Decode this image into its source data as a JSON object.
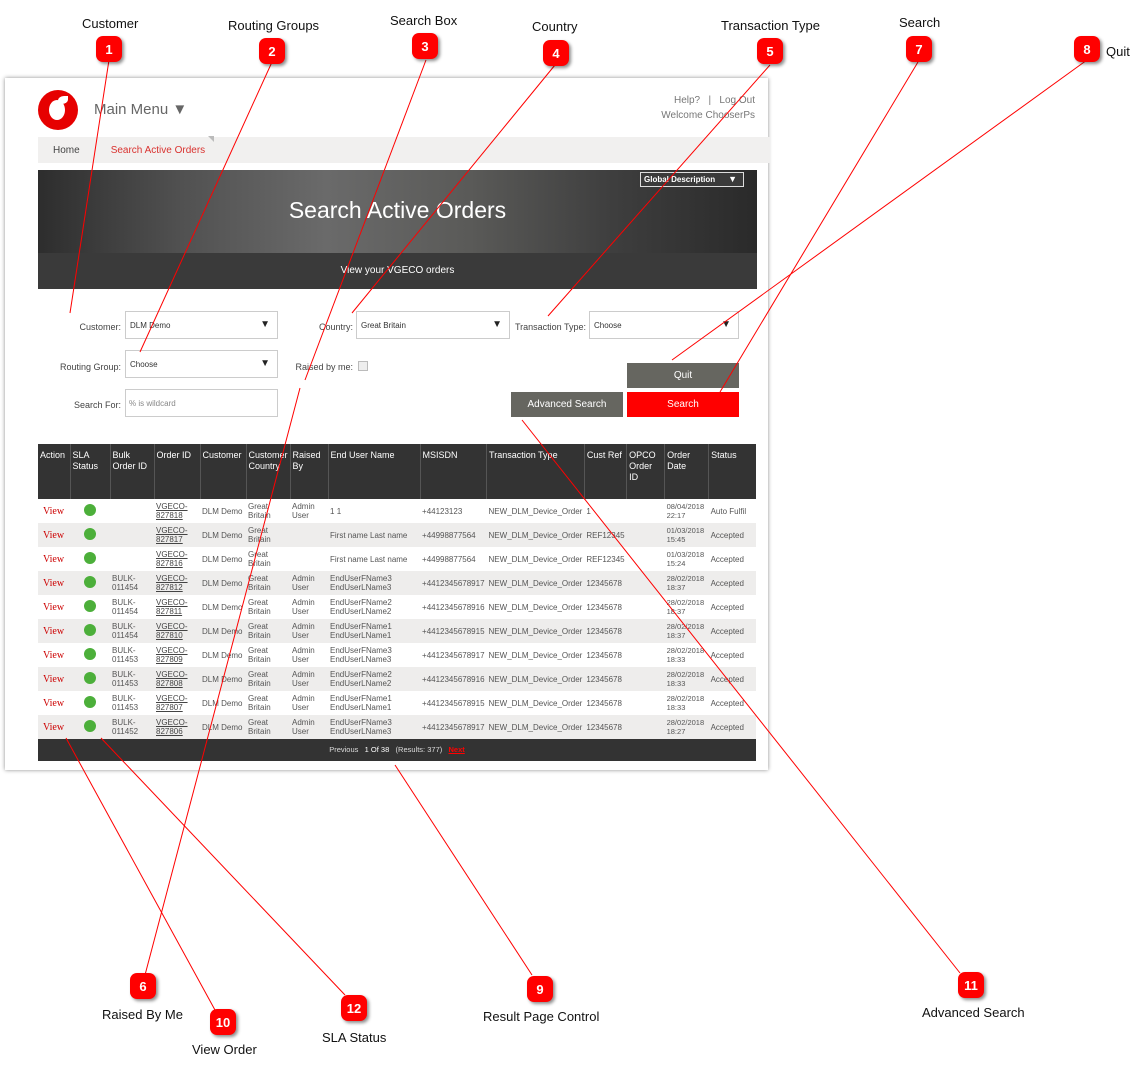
{
  "annotations": [
    {
      "num": "1",
      "label": "Customer"
    },
    {
      "num": "2",
      "label": "Routing Groups"
    },
    {
      "num": "3",
      "label": "Search Box"
    },
    {
      "num": "4",
      "label": "Country"
    },
    {
      "num": "5",
      "label": "Transaction Type"
    },
    {
      "num": "6",
      "label": "Raised By Me"
    },
    {
      "num": "7",
      "label": "Search"
    },
    {
      "num": "8",
      "label": "Quit"
    },
    {
      "num": "9",
      "label": "Result Page Control"
    },
    {
      "num": "10",
      "label": "View Order"
    },
    {
      "num": "11",
      "label": "Advanced Search"
    },
    {
      "num": "12",
      "label": "SLA Status"
    }
  ],
  "header": {
    "main_menu": "Main Menu ▼",
    "help": "Help?",
    "separator": "|",
    "logout": "Log Out",
    "welcome": "Welcome ChooserPs"
  },
  "breadcrumb": {
    "home": "Home",
    "current": "Search Active Orders"
  },
  "hero": {
    "title": "Search Active Orders",
    "subtitle": "View your VGECO orders",
    "global_description": "Global Description",
    "dropdown_arrow": "▼"
  },
  "form": {
    "customer_label": "Customer:",
    "customer_value": "DLM Demo",
    "country_label": "Country:",
    "country_value": "Great Britain",
    "transaction_type_label": "Transaction Type:",
    "transaction_type_value": "Choose",
    "routing_group_label": "Routing Group:",
    "routing_group_value": "Choose",
    "raised_by_me_label": "Raised by me:",
    "search_for_label": "Search For:",
    "search_for_placeholder": "% is wildcard",
    "arrow": "▼",
    "quit": "Quit",
    "advanced_search": "Advanced Search",
    "search": "Search"
  },
  "table": {
    "headers": [
      "Action",
      "SLA Status",
      "Bulk Order ID",
      "Order ID",
      "Customer",
      "Customer Country",
      "Raised By",
      "End User Name",
      "MSISDN",
      "Transaction Type",
      "Cust Ref",
      "OPCO Order ID",
      "Order Date",
      "Status"
    ],
    "rows": [
      {
        "action": "View",
        "sla": "green",
        "bulk": "",
        "order": "VGECO-827818",
        "customer": "DLM Demo",
        "country": "Great Britain",
        "raised_by": "Admin User",
        "end_user": "1 1",
        "msisdn": "+44123123",
        "type": "NEW_DLM_Device_Order",
        "cust_ref": "1",
        "opco": "",
        "date": "08/04/2018 22:17",
        "status": "Auto Fulfil"
      },
      {
        "action": "View",
        "sla": "green",
        "bulk": "",
        "order": "VGECO-827817",
        "customer": "DLM Demo",
        "country": "Great Britain",
        "raised_by": "",
        "end_user": "First name Last name",
        "msisdn": "+44998877564",
        "type": "NEW_DLM_Device_Order",
        "cust_ref": "REF12345",
        "opco": "",
        "date": "01/03/2018 15:45",
        "status": "Accepted"
      },
      {
        "action": "View",
        "sla": "green",
        "bulk": "",
        "order": "VGECO-827816",
        "customer": "DLM Demo",
        "country": "Great Britain",
        "raised_by": "",
        "end_user": "First name Last name",
        "msisdn": "+44998877564",
        "type": "NEW_DLM_Device_Order",
        "cust_ref": "REF12345",
        "opco": "",
        "date": "01/03/2018 15:24",
        "status": "Accepted"
      },
      {
        "action": "View",
        "sla": "green",
        "bulk": "BULK-011454",
        "order": "VGECO-827812",
        "customer": "DLM Demo",
        "country": "Great Britain",
        "raised_by": "Admin User",
        "end_user": "EndUserFName3 EndUserLName3",
        "msisdn": "+4412345678917",
        "type": "NEW_DLM_Device_Order",
        "cust_ref": "12345678",
        "opco": "",
        "date": "28/02/2018 18:37",
        "status": "Accepted"
      },
      {
        "action": "View",
        "sla": "green",
        "bulk": "BULK-011454",
        "order": "VGECO-827811",
        "customer": "DLM Demo",
        "country": "Great Britain",
        "raised_by": "Admin User",
        "end_user": "EndUserFName2 EndUserLName2",
        "msisdn": "+4412345678916",
        "type": "NEW_DLM_Device_Order",
        "cust_ref": "12345678",
        "opco": "",
        "date": "28/02/2018 18:37",
        "status": "Accepted"
      },
      {
        "action": "View",
        "sla": "green",
        "bulk": "BULK-011454",
        "order": "VGECO-827810",
        "customer": "DLM Demo",
        "country": "Great Britain",
        "raised_by": "Admin User",
        "end_user": "EndUserFName1 EndUserLName1",
        "msisdn": "+4412345678915",
        "type": "NEW_DLM_Device_Order",
        "cust_ref": "12345678",
        "opco": "",
        "date": "28/02/2018 18:37",
        "status": "Accepted"
      },
      {
        "action": "View",
        "sla": "green",
        "bulk": "BULK-011453",
        "order": "VGECO-827809",
        "customer": "DLM Demo",
        "country": "Great Britain",
        "raised_by": "Admin User",
        "end_user": "EndUserFName3 EndUserLName3",
        "msisdn": "+4412345678917",
        "type": "NEW_DLM_Device_Order",
        "cust_ref": "12345678",
        "opco": "",
        "date": "28/02/2018 18:33",
        "status": "Accepted"
      },
      {
        "action": "View",
        "sla": "green",
        "bulk": "BULK-011453",
        "order": "VGECO-827808",
        "customer": "DLM Demo",
        "country": "Great Britain",
        "raised_by": "Admin User",
        "end_user": "EndUserFName2 EndUserLName2",
        "msisdn": "+4412345678916",
        "type": "NEW_DLM_Device_Order",
        "cust_ref": "12345678",
        "opco": "",
        "date": "28/02/2018 18:33",
        "status": "Accepted"
      },
      {
        "action": "View",
        "sla": "green",
        "bulk": "BULK-011453",
        "order": "VGECO-827807",
        "customer": "DLM Demo",
        "country": "Great Britain",
        "raised_by": "Admin User",
        "end_user": "EndUserFName1 EndUserLName1",
        "msisdn": "+4412345678915",
        "type": "NEW_DLM_Device_Order",
        "cust_ref": "12345678",
        "opco": "",
        "date": "28/02/2018 18:33",
        "status": "Accepted"
      },
      {
        "action": "View",
        "sla": "green",
        "bulk": "BULK-011452",
        "order": "VGECO-827806",
        "customer": "DLM Demo",
        "country": "Great Britain",
        "raised_by": "Admin User",
        "end_user": "EndUserFName3 EndUserLName3",
        "msisdn": "+4412345678917",
        "type": "NEW_DLM_Device_Order",
        "cust_ref": "12345678",
        "opco": "",
        "date": "28/02/2018 18:27",
        "status": "Accepted"
      }
    ]
  },
  "pager": {
    "previous": "Previous",
    "page": "1 Of 38",
    "results": "(Results: 377)",
    "next": "Next"
  },
  "colors": {
    "accent": "#e60000",
    "sla_green": "#4caf3a",
    "header_dark": "#333333",
    "button_gray": "#666660"
  }
}
